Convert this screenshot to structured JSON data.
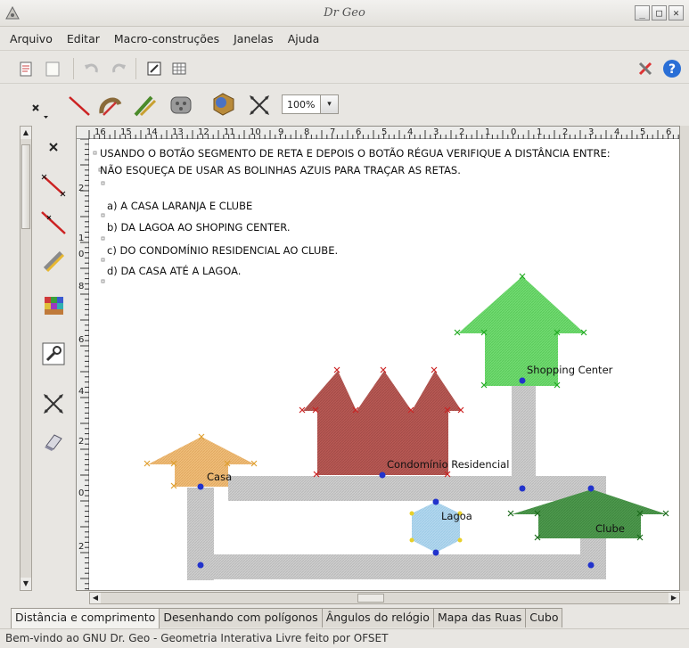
{
  "window": {
    "title": "Dr Geo",
    "minimize": "_",
    "maximize": "□",
    "close": "✕"
  },
  "menu": [
    "Arquivo",
    "Editar",
    "Macro-construções",
    "Janelas",
    "Ajuda"
  ],
  "zoom": {
    "value": "100%",
    "arrow": "▾"
  },
  "ruler": {
    "top": [
      "16",
      "15",
      "14",
      "13",
      "12",
      "11",
      "10",
      "9",
      "8",
      "7",
      "6",
      "5",
      "4",
      "3",
      "2",
      "1",
      "0",
      "1",
      "2",
      "3",
      "4",
      "5",
      "6"
    ],
    "left": [
      "2",
      "1",
      "0",
      "8",
      "6",
      "4",
      "2",
      "0",
      "2"
    ]
  },
  "canvas": {
    "instruction_1": "USANDO O BOTÃO SEGMENTO DE RETA E DEPOIS O BOTÃO RÉGUA VERIFIQUE A DISTÂNCIA ENTRE:",
    "instruction_2": "NÃO ESQUEÇA DE USAR AS BOLINHAS AZUIS PARA TRAÇAR AS RETAS.",
    "items": [
      "a) A CASA LARANJA E CLUBE",
      "b) DA LAGOA AO SHOPING CENTER.",
      "c) DO CONDOMÍNIO RESIDENCIAL AO CLUBE.",
      "d) DA CASA ATÉ A LAGOA."
    ],
    "labels": {
      "shopping": "Shopping Center",
      "condominio": "Condomínio Residencial",
      "casa": "Casa",
      "lagoa": "Lagoa",
      "clube": "Clube"
    }
  },
  "tabs": [
    "Distância e comprimento",
    "Desenhando com polígonos",
    "Ângulos do relógio",
    "Mapa das Ruas",
    "Cubo"
  ],
  "status": "Bem-vindo ao GNU Dr. Geo - Geometria Interativa Livre feito por OFSET",
  "colors": {
    "house_orange": "#f0be7a",
    "condo_red": "#b85a55",
    "shopping_green": "#72dc72",
    "lake_blue": "#b4d8ef",
    "club_green": "#4e9a4e",
    "street_gray": "#cfcfcf",
    "point_blue": "#2233cc"
  }
}
